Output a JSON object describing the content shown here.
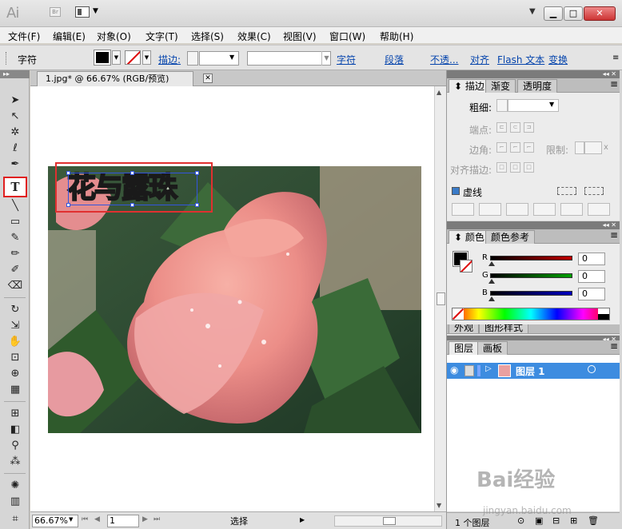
{
  "app": {
    "logo": "Ai",
    "bridge": "Br"
  },
  "menu": [
    "文件(F)",
    "编辑(E)",
    "对象(O)",
    "文字(T)",
    "选择(S)",
    "效果(C)",
    "视图(V)",
    "窗口(W)",
    "帮助(H)"
  ],
  "control": {
    "type_label": "字符",
    "stroke_label": "描边:",
    "links": [
      "字符",
      "段落",
      "不透...",
      "对齐",
      "Flash 文本",
      "变换"
    ]
  },
  "document": {
    "tab_title": "1.jpg* @ 66.67% (RGB/预览)",
    "art_text": "花与露珠"
  },
  "status": {
    "zoom": "66.67%",
    "page": "1",
    "tool": "选择"
  },
  "stroke_panel": {
    "tabs": [
      "描边",
      "渐变",
      "透明度"
    ],
    "weight_label": "粗细:",
    "cap_label": "端点:",
    "corner_label": "边角:",
    "limit_label": "限制:",
    "align_label": "对齐描边:",
    "dashed_label": "虚线",
    "limit_unit": "x"
  },
  "color_panel": {
    "tabs": [
      "颜色",
      "颜色参考"
    ],
    "channels": [
      {
        "name": "R",
        "value": "0"
      },
      {
        "name": "G",
        "value": "0"
      },
      {
        "name": "B",
        "value": "0"
      }
    ],
    "colors": {
      "red": "#c00000",
      "green": "#00a000",
      "blue": "#0000c0"
    }
  },
  "appearance_panel": {
    "tabs": [
      "外观",
      "图形样式"
    ]
  },
  "layers_panel": {
    "tabs": [
      "图层",
      "画板"
    ],
    "layers": [
      {
        "name": "图层 1"
      }
    ],
    "footer": "1 个图层"
  },
  "watermark": {
    "brand": "Bai经验",
    "url": "jingyan.baidu.com"
  }
}
